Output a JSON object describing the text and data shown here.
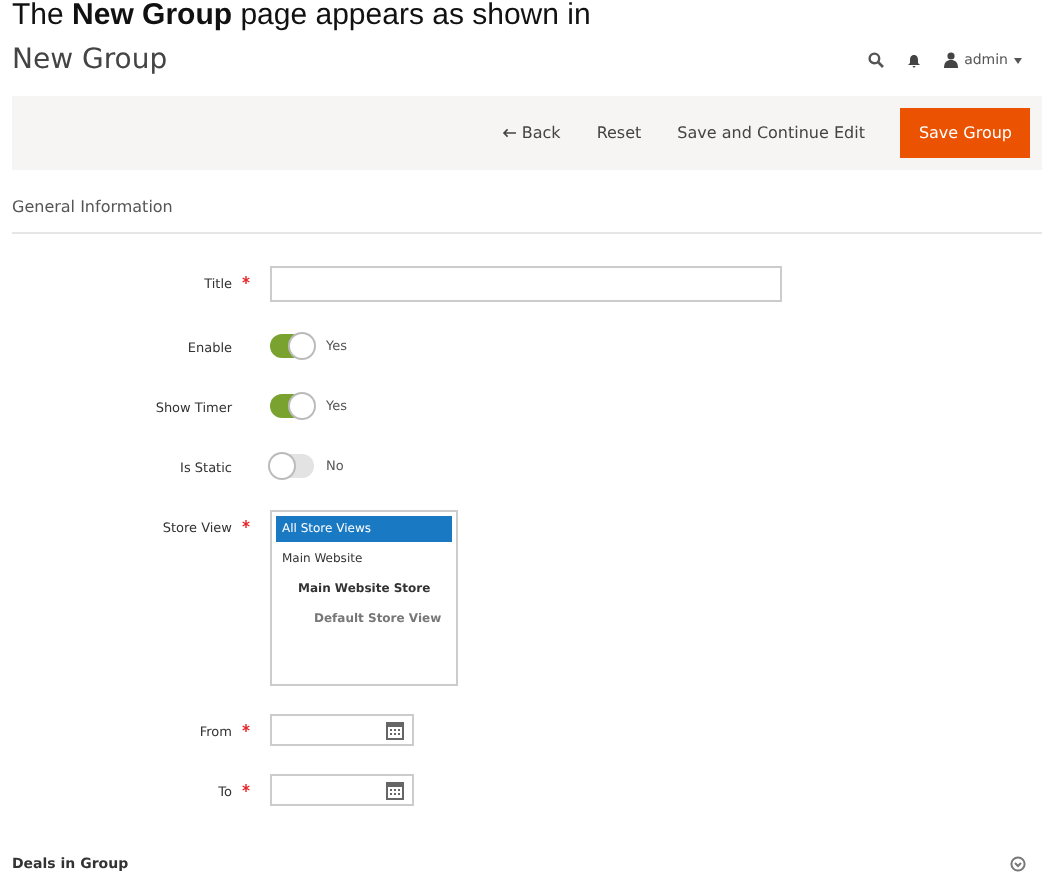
{
  "caption": "The **New Group** page appears as shown in",
  "header": {
    "title": "New Group",
    "user": "admin"
  },
  "toolbar": {
    "back": "Back",
    "reset": "Reset",
    "save_continue": "Save and Continue Edit",
    "save": "Save Group"
  },
  "section": {
    "title": "General Information"
  },
  "fields": [
    {
      "kind": "text",
      "label": "Title",
      "required": true
    },
    {
      "kind": "toggle",
      "label": "Enable",
      "required": false,
      "on": true,
      "value": "Yes"
    },
    {
      "kind": "toggle",
      "label": "Show Timer",
      "required": false,
      "on": true,
      "value": "Yes"
    },
    {
      "kind": "toggle",
      "label": "Is Static",
      "required": false,
      "on": false,
      "value": "No"
    },
    {
      "kind": "multiselect",
      "label": "Store View",
      "required": true,
      "options": [
        {
          "label": "All Store Views",
          "selected": true
        },
        {
          "label": "Main Website",
          "selected": false,
          "children": [
            {
              "label": "Main Website Store",
              "selected": false,
              "children": [
                {
                  "label": "Default Store View",
                  "selected": false
                }
              ]
            }
          ]
        }
      ]
    },
    {
      "kind": "date",
      "label": "From",
      "required": true
    },
    {
      "kind": "date",
      "label": "To",
      "required": true
    }
  ],
  "deals": {
    "title": "Deals in Group"
  }
}
